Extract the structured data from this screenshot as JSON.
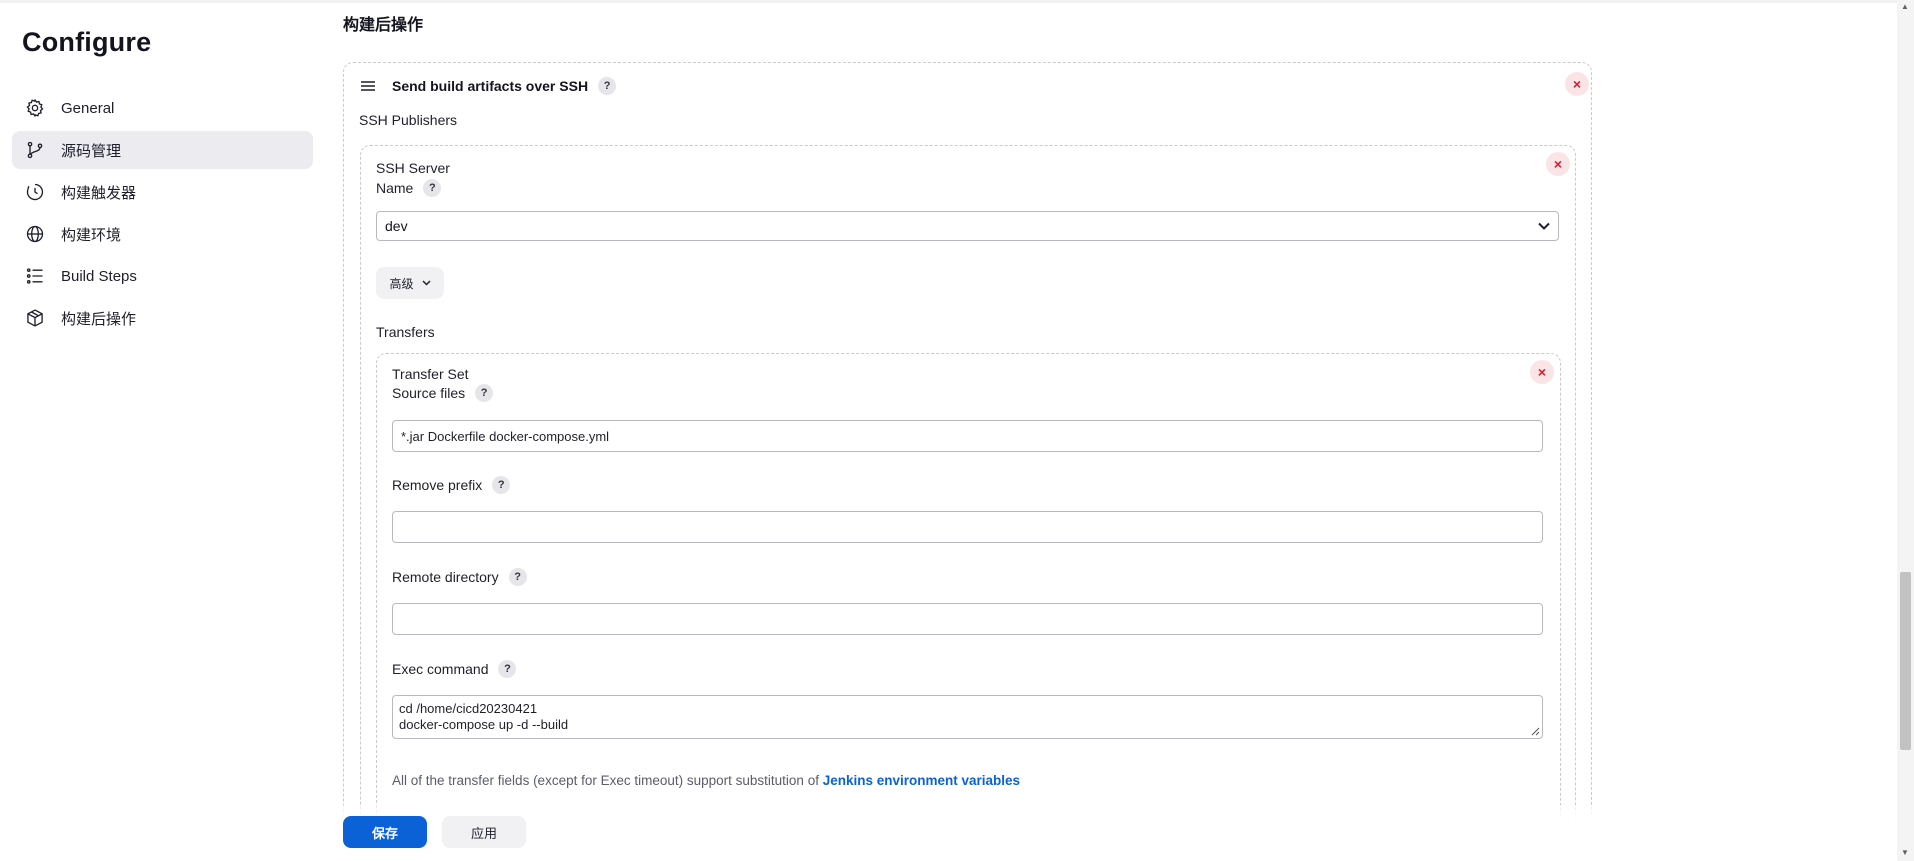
{
  "page": {
    "title": "Configure"
  },
  "sidebar": {
    "items": [
      {
        "label": "General",
        "icon": "gear-icon"
      },
      {
        "label": "源码管理",
        "icon": "git-branch-icon",
        "active": true
      },
      {
        "label": "构建触发器",
        "icon": "clock-icon"
      },
      {
        "label": "构建环境",
        "icon": "globe-icon"
      },
      {
        "label": "Build Steps",
        "icon": "list-icon"
      },
      {
        "label": "构建后操作",
        "icon": "package-icon"
      }
    ]
  },
  "main": {
    "section_title": "构建后操作",
    "publisher": {
      "title": "Send build artifacts over SSH",
      "publishers_label": "SSH Publishers",
      "server": {
        "header": "SSH Server",
        "name_label": "Name",
        "name_value": "dev",
        "advanced_label": "高级",
        "transfers_label": "Transfers",
        "transfer_set": {
          "header": "Transfer Set",
          "source_files_label": "Source files",
          "source_files_value": "*.jar Dockerfile docker-compose.yml",
          "remove_prefix_label": "Remove prefix",
          "remove_prefix_value": "",
          "remote_directory_label": "Remote directory",
          "remote_directory_value": "",
          "exec_command_label": "Exec command",
          "exec_command_lines": [
            "cd /home/cicd20230421",
            "docker-compose up -d --build"
          ],
          "note_text": "All of the transfer fields (except for Exec timeout) support substitution of ",
          "note_link": "Jenkins environment variables"
        }
      }
    }
  },
  "footer": {
    "save_label": "保存",
    "apply_label": "应用"
  },
  "help_glyph": "?",
  "close_glyph": "×",
  "colors": {
    "primary": "#0b62d6",
    "danger": "#d41a2a",
    "active_bg": "#ebebf0"
  }
}
